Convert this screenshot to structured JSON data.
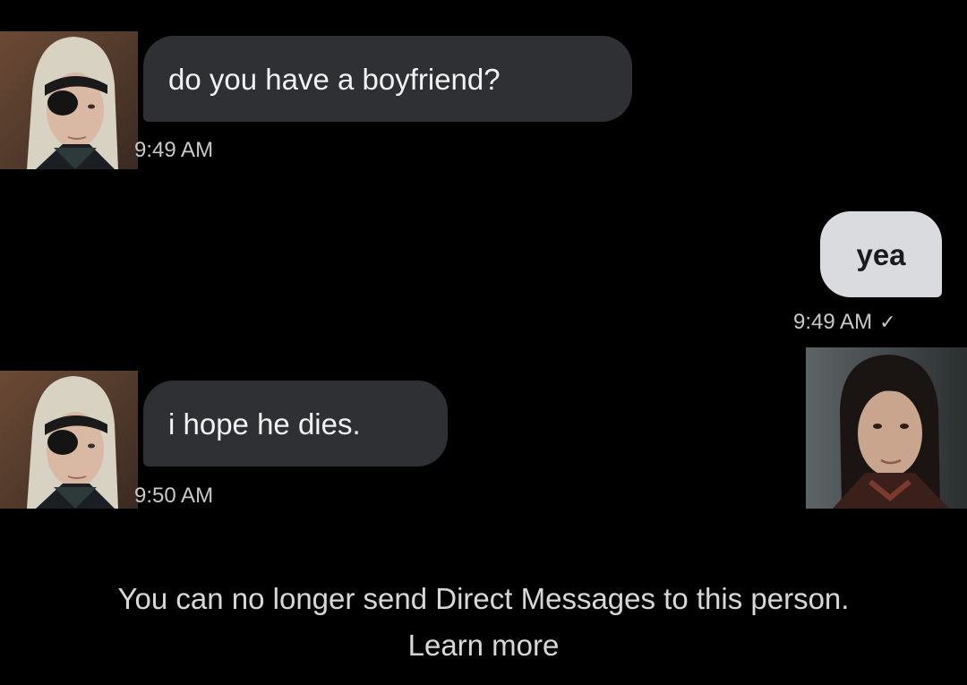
{
  "messages": [
    {
      "direction": "incoming",
      "text": "do you have a boyfriend?",
      "time": "9:49 AM"
    },
    {
      "direction": "outgoing",
      "text": "yea",
      "time": "9:49 AM",
      "status_icon": "checkmark-icon"
    },
    {
      "direction": "incoming",
      "text": "i hope he dies.",
      "time": "9:50 AM"
    }
  ],
  "footer": {
    "notice": "You can no longer send Direct Messages to this person.",
    "learn_more": "Learn more"
  },
  "colors": {
    "background": "#000000",
    "incoming_bubble": "#2f3033",
    "outgoing_bubble": "#d9dbdf",
    "meta_text": "#c9c9c9"
  },
  "icons": {
    "sender_avatar": "avatar-eyepatch-man",
    "recipient_avatar": "avatar-dark-haired-man",
    "read_receipt": "checkmark-icon"
  }
}
